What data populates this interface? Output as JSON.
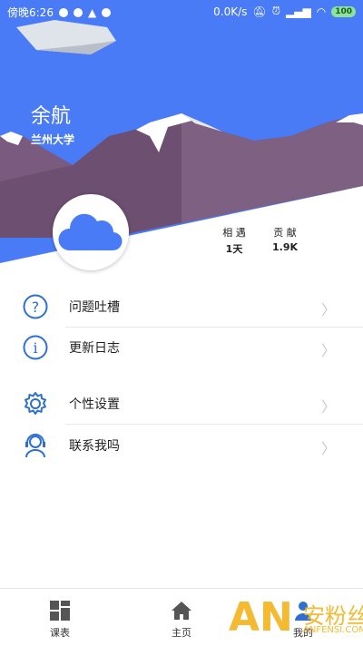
{
  "status_bar": {
    "time": "傍晚6:26",
    "net_speed": "0.0K/s",
    "battery": "100"
  },
  "profile": {
    "name": "余航",
    "school": "兰州大学",
    "stats": [
      {
        "label": "相 遇",
        "value": "1天"
      },
      {
        "label": "贡 献",
        "value": "1.9K"
      }
    ]
  },
  "menu": [
    {
      "label": "问题吐槽",
      "icon": "question-circle-icon"
    },
    {
      "label": "更新日志",
      "icon": "info-circle-icon"
    },
    {
      "label": "个性设置",
      "icon": "gear-icon"
    },
    {
      "label": "联系我吗",
      "icon": "support-agent-icon"
    }
  ],
  "tabs": [
    {
      "label": "课表",
      "icon": "grid-icon"
    },
    {
      "label": "主页",
      "icon": "home-icon"
    },
    {
      "label": "我的",
      "icon": "person-icon"
    }
  ],
  "watermark": {
    "text": "安粉丝",
    "sub": "ANFENSI.COM",
    "logo": "AN"
  },
  "colors": {
    "header_blue": "#4a7bf7",
    "mountain": "#7a5a7e",
    "icon_blue": "#2f6fce"
  }
}
